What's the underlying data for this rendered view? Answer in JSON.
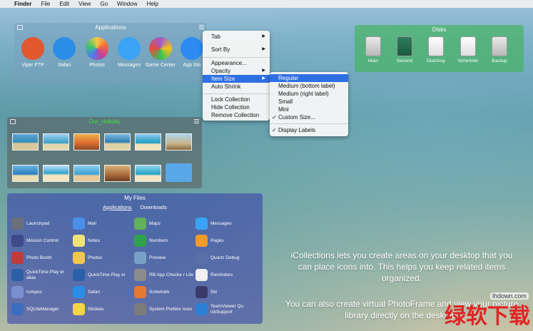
{
  "menubar": {
    "apple": "",
    "app": "Finder",
    "items": [
      "File",
      "Edit",
      "View",
      "Go",
      "Window",
      "Help"
    ]
  },
  "apps": {
    "title": "Applications",
    "items": [
      {
        "label": "Viper FTP",
        "color": "#e3572f"
      },
      {
        "label": "Safari",
        "color": "#2a8de6"
      },
      {
        "label": "Photos",
        "color": "#f3c84a"
      },
      {
        "label": "Messages",
        "color": "#3ba3f6"
      },
      {
        "label": "Game Center",
        "color": "#9b59d0"
      },
      {
        "label": "App Sto",
        "color": "#2b8bf1"
      }
    ]
  },
  "disks": {
    "title": "Disks",
    "items": [
      "Main",
      "Second",
      "DiskXray",
      "Scherlokk",
      "Backup"
    ]
  },
  "holiday": {
    "title": "Our_Holiday"
  },
  "files": {
    "title": "My Files",
    "tabs": [
      "Applications",
      "Downloads"
    ],
    "items": [
      {
        "label": "Launchpad",
        "color": "#6c6f7a"
      },
      {
        "label": "Mail",
        "color": "#4a8fe8"
      },
      {
        "label": "Maps",
        "color": "#63b15a"
      },
      {
        "label": "Messages",
        "color": "#3ba3f6"
      },
      {
        "label": "Mission Control",
        "color": "#3f4a8a"
      },
      {
        "label": "Notes",
        "color": "#f2e27a"
      },
      {
        "label": "Numbers",
        "color": "#2fa24c"
      },
      {
        "label": "Pages",
        "color": "#f19b2a"
      },
      {
        "label": "Photo Booth",
        "color": "#c33a3a"
      },
      {
        "label": "Photos",
        "color": "#f3c84a"
      },
      {
        "label": "Preview",
        "color": "#7aa0c8"
      },
      {
        "label": "Quartz Debug",
        "color": "#5a6fa8"
      },
      {
        "label": "QuickTime Play er alias",
        "color": "#2b5fa8"
      },
      {
        "label": "QuickTime Play er",
        "color": "#2b5fa8"
      },
      {
        "label": "RB App Checke r Lite",
        "color": "#8c8c8c"
      },
      {
        "label": "Reminders",
        "color": "#f0f0f0"
      },
      {
        "label": "rumpus",
        "color": "#7b8fd0"
      },
      {
        "label": "Safari",
        "color": "#2a8de6"
      },
      {
        "label": "Scherlokk",
        "color": "#e57832"
      },
      {
        "label": "Siri",
        "color": "#3a3a6a"
      },
      {
        "label": "SQLiteManager",
        "color": "#3b6fc0"
      },
      {
        "label": "Stickies",
        "color": "#f5d447"
      },
      {
        "label": "System Prefere nces",
        "color": "#7b7b7b"
      },
      {
        "label": "TeamViewer Qu ickSupport",
        "color": "#2d7fd6"
      }
    ]
  },
  "context_menu": {
    "items": [
      "Tab",
      "Sort By",
      "Appearance...",
      "Opacity",
      "Item Size",
      "Auto Shrink",
      "Lock Collection",
      "Hide Collection",
      "Remove Collection"
    ],
    "highlighted": "Item Size"
  },
  "submenu": {
    "items": [
      "Regular",
      "Medium (bottom label)",
      "Medium (right label)",
      "Small",
      "Mini",
      "Custom Size...",
      "Display Labels"
    ],
    "highlighted": "Regular",
    "checked": [
      "Custom Size...",
      "Display Labels"
    ]
  },
  "description": {
    "p1": "iCollections lets you create areas on your desktop that you can place icons into. This helps you keep related items organized.",
    "p2": "You can also create virtual PhotoFrame and view your picture library directly on the desktop."
  },
  "watermark": {
    "url": "lhdown.com",
    "text": "绿软下载"
  }
}
